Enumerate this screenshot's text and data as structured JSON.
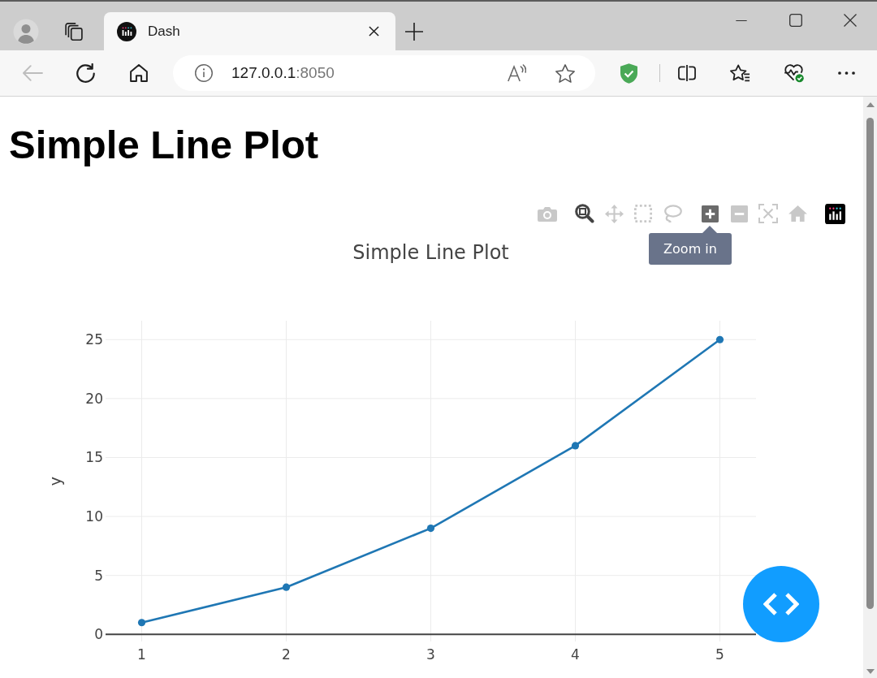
{
  "browser": {
    "tabs": [
      {
        "title": "Dash",
        "selected": true
      }
    ],
    "nav_buttons": [
      {
        "kind": "back",
        "disabled": true
      },
      {
        "kind": "refresh",
        "disabled": false
      },
      {
        "kind": "home",
        "disabled": false
      }
    ],
    "address": {
      "host": "127.0.0.1",
      "port": ":8050"
    }
  },
  "page": {
    "heading": "Simple Line Plot"
  },
  "graph": {
    "modebar": {
      "groups": [
        {
          "buttons": [
            {
              "kind": "camera",
              "selected": false,
              "hovered": false
            }
          ]
        },
        {
          "buttons": [
            {
              "kind": "zoom",
              "selected": true,
              "hovered": false
            },
            {
              "kind": "pan",
              "selected": false,
              "hovered": false
            },
            {
              "kind": "box-select",
              "selected": false,
              "hovered": false
            },
            {
              "kind": "lasso",
              "selected": false,
              "hovered": false
            }
          ]
        },
        {
          "buttons": [
            {
              "kind": "zoom-in",
              "selected": false,
              "hovered": true
            },
            {
              "kind": "zoom-out",
              "selected": false,
              "hovered": false
            },
            {
              "kind": "autoscale",
              "selected": false,
              "hovered": false
            },
            {
              "kind": "reset",
              "selected": false,
              "hovered": false
            }
          ]
        },
        {
          "buttons": [
            {
              "kind": "logo"
            }
          ]
        }
      ]
    },
    "tooltip": "Zoom in",
    "chart_data": {
      "type": "line",
      "title": "Simple Line Plot",
      "ylabel": "y",
      "x": [
        1,
        2,
        3,
        4,
        5
      ],
      "series": [
        {
          "color": "#1f77b4",
          "marker": true,
          "values": [
            1,
            4,
            9,
            16,
            25
          ]
        }
      ],
      "xlim": [
        0.75,
        5.25
      ],
      "ylim": [
        -0.6,
        26.6
      ],
      "xticks": [
        1,
        2,
        3,
        4,
        5
      ],
      "yticks": [
        0,
        5,
        10,
        15,
        20,
        25
      ],
      "grid": true
    }
  }
}
